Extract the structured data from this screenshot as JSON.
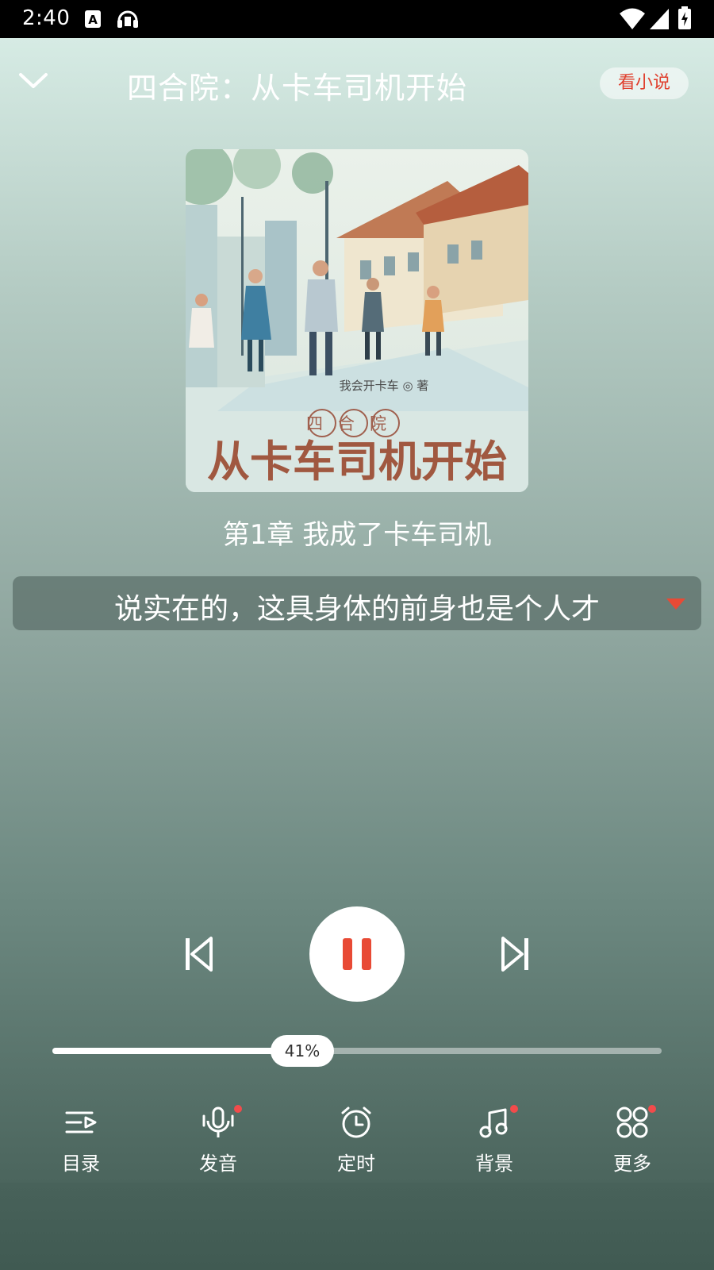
{
  "status_bar": {
    "time": "2:40"
  },
  "header": {
    "title": "四合院：从卡车司机开始",
    "read_novel_label": "看小说"
  },
  "cover": {
    "author_line": "我会开卡车 ◎ 著",
    "series_label": "四合院",
    "book_title": "从卡车司机开始"
  },
  "chapter_title": "第1章 我成了卡车司机",
  "current_sentence": "说实在的，这具身体的前身也是个人才",
  "progress": {
    "percent": 41,
    "label": "41%"
  },
  "menu": [
    {
      "label": "目录",
      "icon": "catalog-icon",
      "dot": false
    },
    {
      "label": "发音",
      "icon": "microphone-icon",
      "dot": true
    },
    {
      "label": "定时",
      "icon": "alarm-clock-icon",
      "dot": false
    },
    {
      "label": "背景",
      "icon": "music-note-icon",
      "dot": true
    },
    {
      "label": "更多",
      "icon": "more-grid-icon",
      "dot": true
    }
  ],
  "colors": {
    "accent": "#e84a35",
    "dot": "#f24b4b"
  }
}
